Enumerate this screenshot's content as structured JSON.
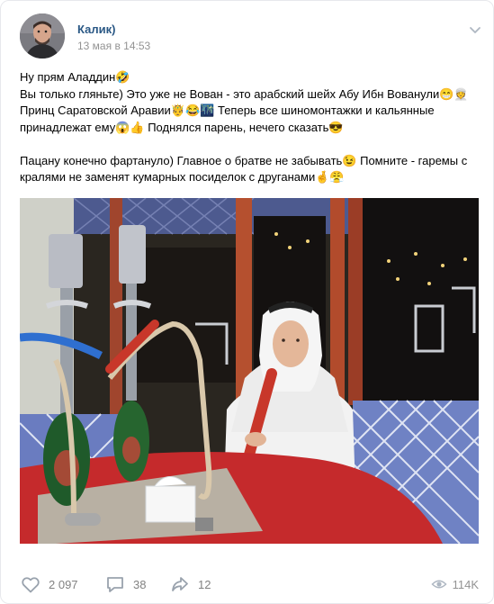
{
  "post": {
    "author": "Калик)",
    "date": "13 мая в 14:53",
    "text_paragraphs": [
      "Ну прям Аладдин🤣\nВы только гляньте) Это уже не Вован - это арабский шейх Абу Ибн Вованули😁👳\nПринц Саратовской Аравии🤴😂🌃 Теперь все шиномонтажки и кальянные принадлежат ему😱👍 Поднялся парень, нечего сказать😎",
      "Пацану конечно фартануло) Главное о братве не забывать😉 Помните - гаремы с кралями не заменят кумарных посиделок с друганами🤞😤"
    ]
  },
  "actions": {
    "likes": "2 097",
    "comments": "38",
    "shares": "12",
    "views": "114K"
  },
  "icons": {
    "more": "chevron-down-icon",
    "like": "heart-icon",
    "comment": "comment-icon",
    "share": "share-icon",
    "views": "eye-icon"
  },
  "colors": {
    "author": "#2a5885",
    "meta": "#939393",
    "icon": "#99a2ad"
  }
}
